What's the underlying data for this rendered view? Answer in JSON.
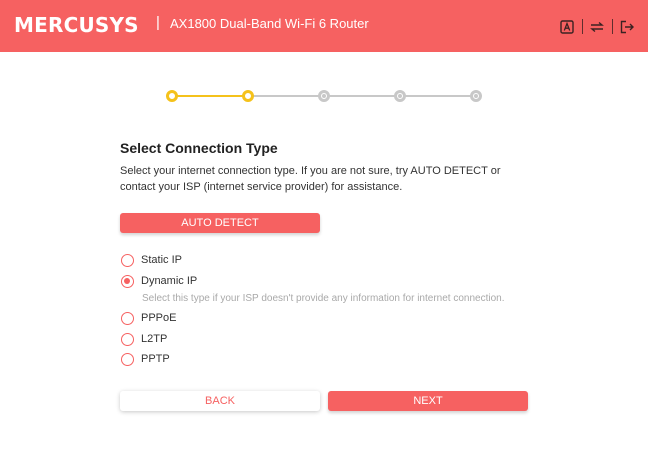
{
  "header": {
    "brand": "MERCUSYS",
    "separator": "|",
    "model": "AX1800 Dual-Band Wi-Fi 6 Router",
    "icons": [
      "language-icon",
      "network-switch-icon",
      "logout-icon"
    ],
    "color": "#f66161"
  },
  "stepper": {
    "total_steps": 5,
    "completed_steps": 2,
    "active_color": "#f5c21b",
    "inactive_color": "#c8c8c8"
  },
  "main": {
    "title": "Select Connection Type",
    "description": "Select your internet connection type. If you are not sure, try AUTO DETECT or contact your ISP (internet service provider) for assistance.",
    "auto_detect_label": "AUTO DETECT",
    "options": [
      {
        "label": "Static IP",
        "checked": false
      },
      {
        "label": "Dynamic IP",
        "checked": true
      },
      {
        "label": "PPPoE",
        "checked": false
      },
      {
        "label": "L2TP",
        "checked": false
      },
      {
        "label": "PPTP",
        "checked": false
      }
    ],
    "dynamic_hint": "Select this type if your ISP doesn't provide any information for internet connection.",
    "back_label": "BACK",
    "next_label": "NEXT"
  }
}
